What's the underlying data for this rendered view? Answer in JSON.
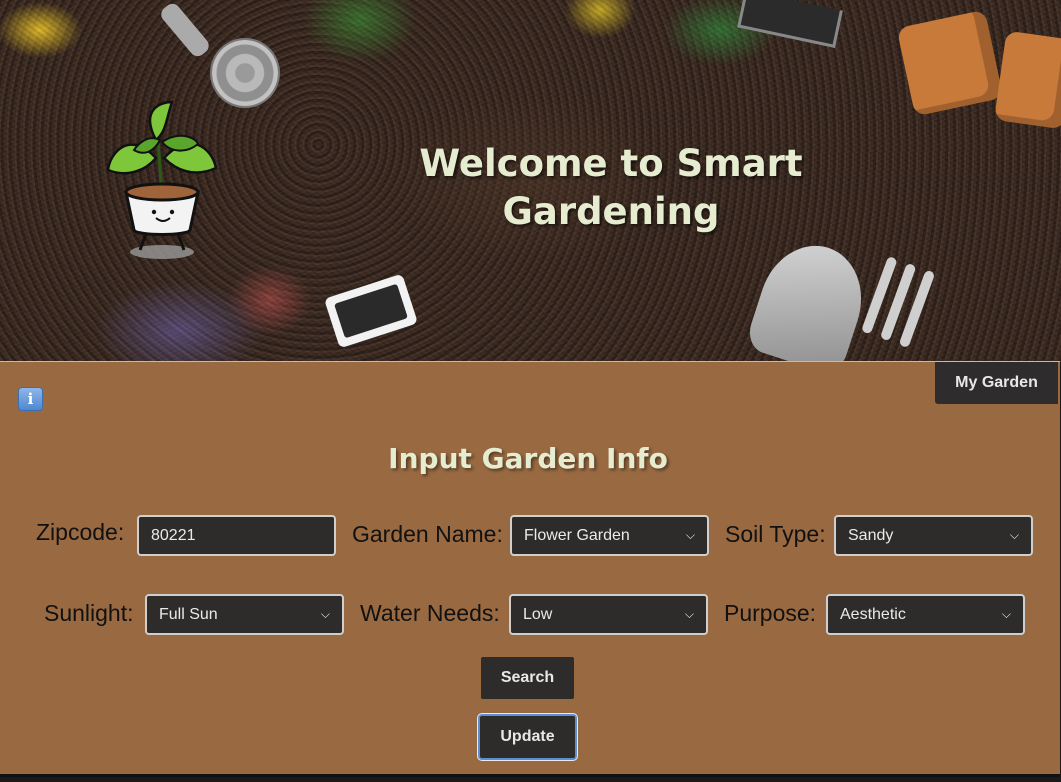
{
  "hero": {
    "title": "Welcome to Smart Gardening"
  },
  "toolbar": {
    "info_icon": "i",
    "my_garden_label": "My Garden"
  },
  "form": {
    "title": "Input Garden Info",
    "zipcode": {
      "label": "Zipcode:",
      "value": "80221"
    },
    "garden_name": {
      "label": "Garden Name:",
      "selected": "Flower Garden"
    },
    "soil_type": {
      "label": "Soil Type:",
      "selected": "Sandy"
    },
    "sunlight": {
      "label": "Sunlight:",
      "selected": "Full Sun"
    },
    "water_needs": {
      "label": "Water Needs:",
      "selected": "Low"
    },
    "purpose": {
      "label": "Purpose:",
      "selected": "Aesthetic"
    },
    "search_label": "Search",
    "update_label": "Update"
  },
  "colors": {
    "panel": "#996a42",
    "control_bg": "#2e2b2b",
    "title_text": "#e6eccf",
    "focus_ring": "#5b8fd1"
  }
}
